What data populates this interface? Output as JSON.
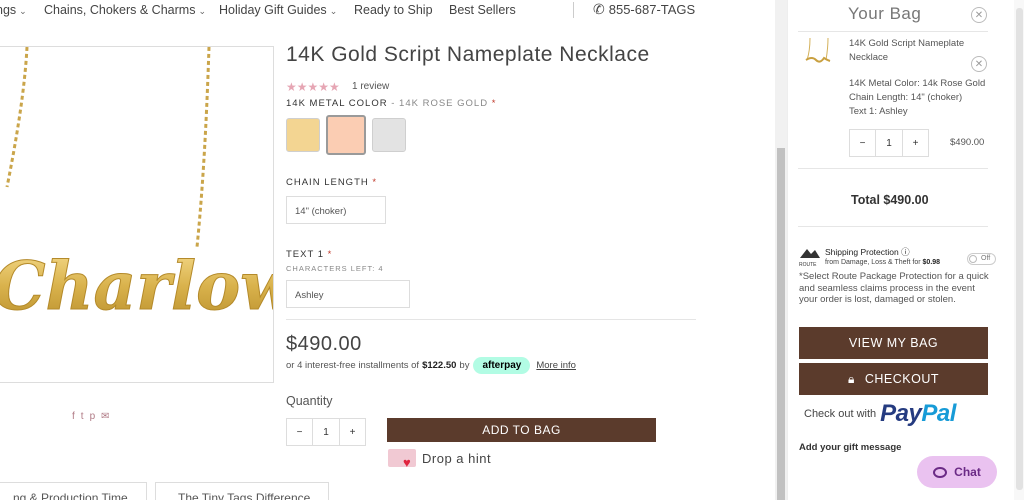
{
  "nav": {
    "items": [
      {
        "label": "ngs"
      },
      {
        "label": "Chains, Chokers & Charms"
      },
      {
        "label": "Holiday Gift Guides"
      },
      {
        "label": "Ready to Ship"
      },
      {
        "label": "Best Sellers"
      }
    ],
    "phone": "855-687-TAGS"
  },
  "product": {
    "image_text": "Charlow",
    "title": "14K Gold Script Nameplate Necklace",
    "stars": "★★★★★",
    "reviews": "1 review",
    "metal_label": "14K METAL COLOR",
    "metal_selected": " - 14K ROSE GOLD",
    "required_mark": " *",
    "swatches": [
      {
        "name": "yellow-gold",
        "color": "#f3d592"
      },
      {
        "name": "rose-gold",
        "color": "#fbcdb3"
      },
      {
        "name": "white-gold",
        "color": "#e3e3e3"
      }
    ],
    "chain_label": "CHAIN LENGTH",
    "chain_value": "14\" (choker)",
    "text1_label": "TEXT 1",
    "chars_left": "CHARACTERS LEFT: 4",
    "text1_value": "Ashley",
    "price": "$490.00",
    "installments_prefix": "or 4 interest-free installments of",
    "installment_amount": "$122.50",
    "installments_by": "by",
    "afterpay": "afterpay",
    "more_info": "More info",
    "quantity_label": "Quantity",
    "quantity": "1",
    "minus": "−",
    "plus": "+",
    "add_to_bag": "ADD TO BAG",
    "drop_hint": "Drop a hint",
    "tabs": [
      "ng & Production Time",
      "The Tiny Tags Difference"
    ]
  },
  "bag": {
    "title": "Your Bag",
    "item_name": "14K Gold Script Nameplate Necklace",
    "opt_metal": "14K Metal Color: 14k Rose Gold",
    "opt_chain": "Chain Length: 14\" (choker)",
    "opt_text": "Text 1: Ashley",
    "quantity": "1",
    "minus": "−",
    "plus": "+",
    "item_price": "$490.00",
    "total": "Total $490.00",
    "route_logo": "ROUTE",
    "route_title": "Shipping Protection",
    "route_sub": "from Damage, Loss & Theft for",
    "route_price": "$0.98",
    "route_toggle": "Off",
    "route_note": "*Select Route Package Protection for a quick and seamless claims process in the event your order is lost, damaged or stolen.",
    "view_bag": "VIEW MY BAG",
    "checkout": "CHECKOUT",
    "checkout_with": "Check out with",
    "paypal_pay": "Pay",
    "paypal_pal": "Pal",
    "gift_message": "Add your gift message",
    "chat": "Chat"
  },
  "colors": {
    "brand_brown": "#5b3b2c",
    "star_pink": "#e6a6b4",
    "afterpay_mint": "#b2fce4",
    "paypal_dark": "#253b80",
    "paypal_light": "#179bd7",
    "chat_bg": "#eac2f0"
  }
}
